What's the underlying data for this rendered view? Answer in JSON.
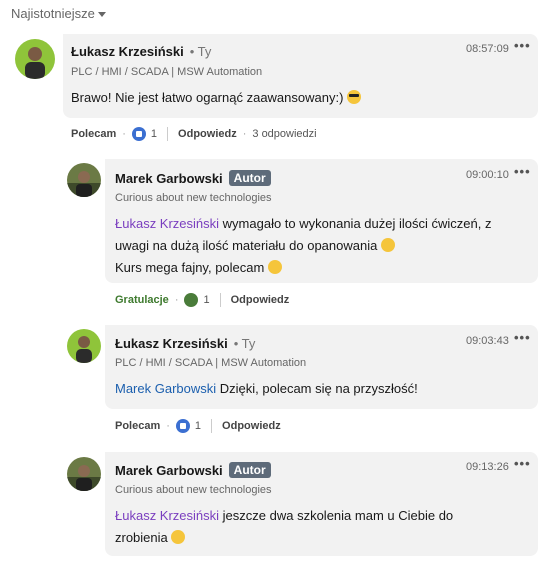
{
  "sort": {
    "label": "Najistotniejsze"
  },
  "comments": [
    {
      "author": "Łukasz Krzesiński",
      "degree": "• Ty",
      "headline": "PLC / HMI / SCADA | MSW Automation",
      "time": "08:57:09",
      "text": "Brawo! Nie jest łatwo ogarnąć zaawansowany:)",
      "actions": {
        "reaction": "Polecam",
        "count": "1",
        "reply": "Odpowiedz",
        "replies": "3 odpowiedzi"
      }
    },
    {
      "author": "Marek Garbowski",
      "badge": "Autor",
      "headline": "Curious about new technologies",
      "time": "09:00:10",
      "mention": "Łukasz Krzesiński",
      "text_line1": " wymagało to wykonania dużej ilości ćwiczeń, z",
      "text_line2": "uwagi na dużą ilość materiału do opanowania",
      "text_line3": "Kurs mega fajny, polecam",
      "actions": {
        "reaction": "Gratulacje",
        "count": "1",
        "reply": "Odpowiedz"
      }
    },
    {
      "author": "Łukasz Krzesiński",
      "degree": "• Ty",
      "headline": "PLC / HMI / SCADA | MSW Automation",
      "time": "09:03:43",
      "mention": "Marek Garbowski",
      "text": " Dzięki, polecam się na przyszłość!",
      "actions": {
        "reaction": "Polecam",
        "count": "1",
        "reply": "Odpowiedz"
      }
    },
    {
      "author": "Marek Garbowski",
      "badge": "Autor",
      "headline": "Curious about new technologies",
      "time": "09:13:26",
      "mention": "Łukasz Krzesiński",
      "text_line1": " jeszcze dwa szkolenia mam u Ciebie do",
      "text_line2": "zrobienia"
    }
  ],
  "colors": {
    "bubble": "#f2f2f2",
    "mention_purple": "#7a3ebf",
    "mention_blue": "#1b5fae",
    "badge": "#5e6b7a"
  },
  "icons": {
    "sort": "caret-down-icon",
    "more": "more-dots-icon",
    "like": "like-icon",
    "praise": "praise-icon"
  }
}
